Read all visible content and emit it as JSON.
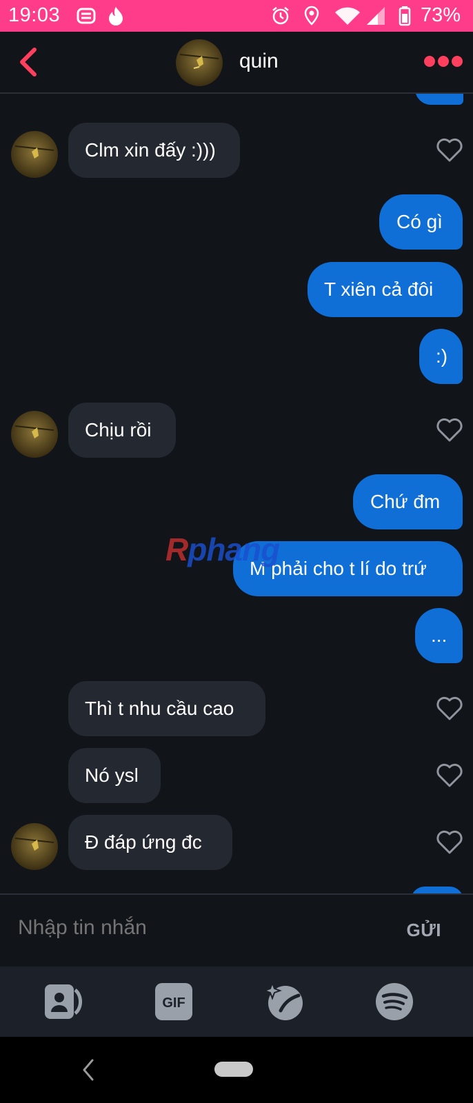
{
  "status_bar": {
    "time": "19:03",
    "battery": "73%",
    "color": "#fe3c8a"
  },
  "header": {
    "contact_name": "quin"
  },
  "messages": [
    {
      "side": "in",
      "text": "Clm xin đấy :)))"
    },
    {
      "side": "out",
      "text": "Có gì"
    },
    {
      "side": "out",
      "text": "T xiên cả đôi"
    },
    {
      "side": "out",
      "text": ":)"
    },
    {
      "side": "in",
      "text": "Chịu rồi"
    },
    {
      "side": "out",
      "text": "Chứ đm"
    },
    {
      "side": "out",
      "text": "M phải cho t lí do trứ"
    },
    {
      "side": "out",
      "text": "..."
    },
    {
      "side": "in",
      "text": "Thì t nhu cầu cao"
    },
    {
      "side": "in",
      "text": "Nó ysl"
    },
    {
      "side": "in",
      "text": "Đ đáp ứng đc"
    }
  ],
  "composer": {
    "placeholder": "Nhập tin nhắn",
    "send_label": "GỬI"
  },
  "toolbar": {
    "items": [
      "contact-card-icon",
      "gif-icon",
      "sparkle-icon",
      "spotify-icon"
    ],
    "gif_label": "GIF"
  },
  "watermark": {
    "text_red": "R",
    "text_blue": "phang"
  },
  "colors": {
    "background": "#111419",
    "incoming_bubble": "#242831",
    "outgoing_bubble": "#0f6fd6",
    "accent": "#fe3c8a",
    "back_arrow": "#ff3f5e"
  }
}
